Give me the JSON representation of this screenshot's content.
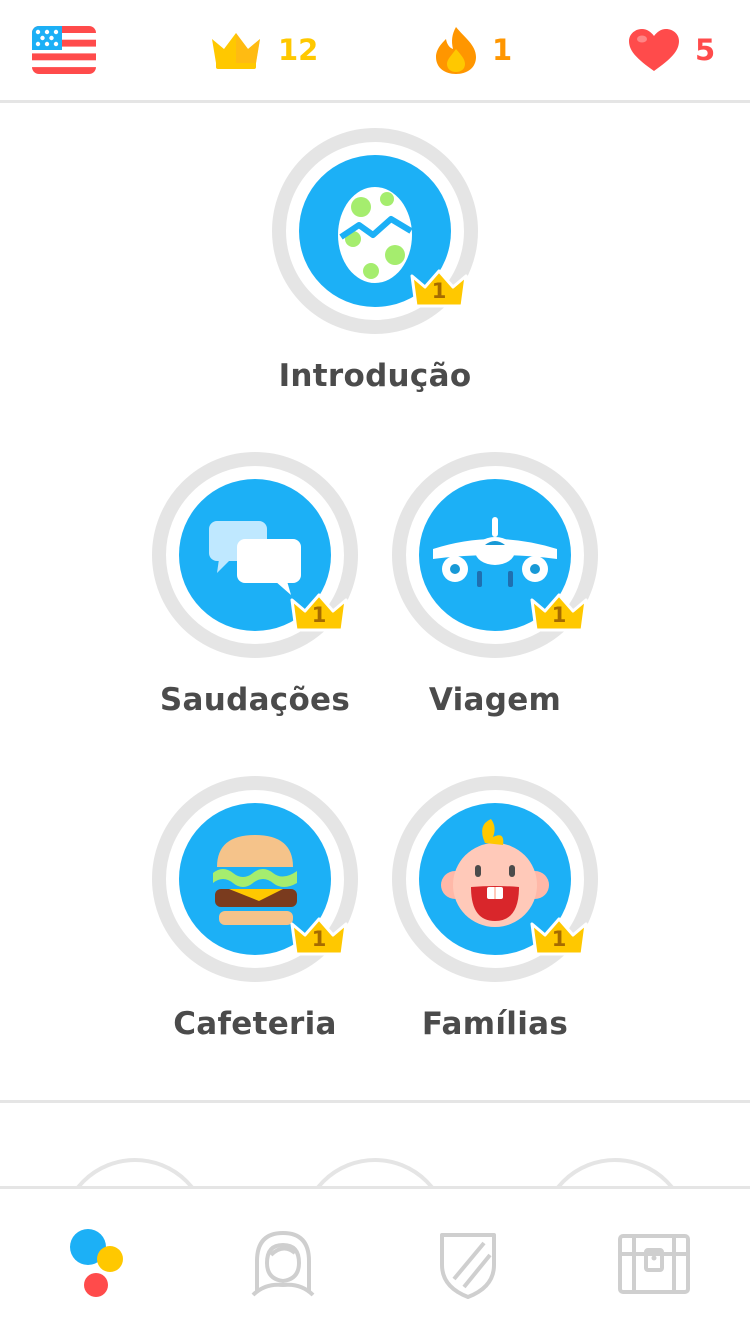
{
  "topbar": {
    "language_flag": "us-flag-icon",
    "crowns": {
      "icon": "crown-icon",
      "count": "12",
      "color": "#ffc800"
    },
    "streak": {
      "icon": "flame-icon",
      "count": "1",
      "color": "#ff9600"
    },
    "hearts": {
      "icon": "heart-icon",
      "count": "5",
      "color": "#ff4b4b"
    }
  },
  "skills": [
    {
      "id": "introducao",
      "label": "Introdução",
      "icon": "egg-icon",
      "crown_level": "1"
    },
    {
      "id": "saudacoes",
      "label": "Saudações",
      "icon": "speech-bubbles-icon",
      "crown_level": "1"
    },
    {
      "id": "viagem",
      "label": "Viagem",
      "icon": "airplane-icon",
      "crown_level": "1"
    },
    {
      "id": "cafeteria",
      "label": "Cafeteria",
      "icon": "burger-icon",
      "crown_level": "1"
    },
    {
      "id": "familias",
      "label": "Famílias",
      "icon": "baby-face-icon",
      "crown_level": "1"
    }
  ],
  "bottom_nav": [
    {
      "id": "learn",
      "icon": "learn-dots-icon",
      "active": true
    },
    {
      "id": "profile",
      "icon": "profile-avatar-icon",
      "active": false
    },
    {
      "id": "leaderboards",
      "icon": "shield-icon",
      "active": false
    },
    {
      "id": "shop",
      "icon": "treasure-chest-icon",
      "active": false
    }
  ],
  "colors": {
    "skill_blue": "#1cb0f6",
    "ring_gray": "#e5e5e5",
    "label_gray": "#4b4b4b",
    "nav_inactive": "#cfcfcf"
  }
}
